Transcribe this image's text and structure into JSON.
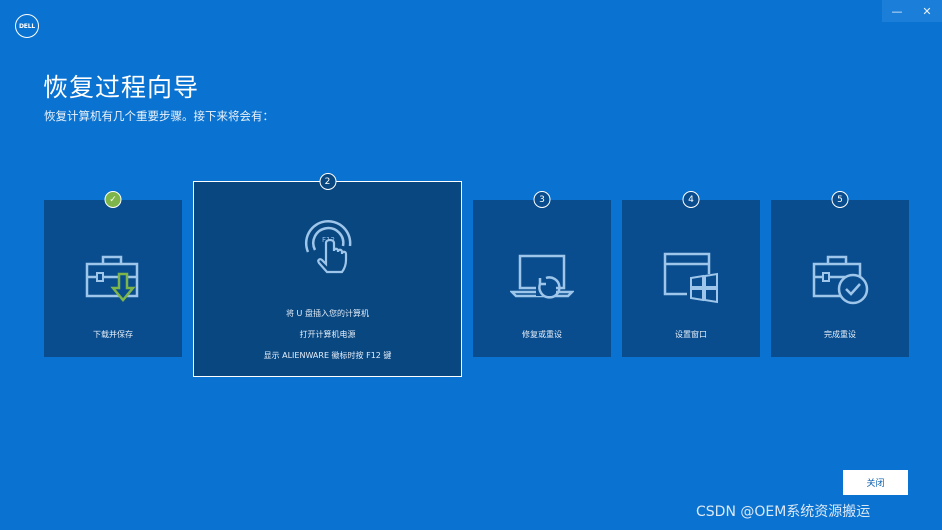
{
  "window": {
    "logo_text": "DELL",
    "minimize_glyph": "—",
    "close_glyph": "✕"
  },
  "header": {
    "title": "恢复过程向导",
    "subtitle": "恢复计算机有几个重要步骤。接下来将会有："
  },
  "steps": [
    {
      "number": "✓",
      "label": "下载并保存",
      "icon": "toolbox-download-icon",
      "state": "done"
    },
    {
      "number": "2",
      "lines": [
        "将 U 盘插入您的计算机",
        "打开计算机电源",
        "显示 ALIENWARE 徽标时按 F12 键"
      ],
      "icon": "finger-press-f12-icon",
      "icon_text": "F12",
      "state": "active"
    },
    {
      "number": "3",
      "label": "修复或重设",
      "icon": "laptop-restore-icon",
      "state": "pending"
    },
    {
      "number": "4",
      "label": "设置窗口",
      "icon": "windows-setup-icon",
      "state": "pending"
    },
    {
      "number": "5",
      "label": "完成重设",
      "icon": "toolbox-check-icon",
      "state": "pending"
    }
  ],
  "footer": {
    "close_label": "关闭",
    "watermark": "CSDN @OEM系统资源搬运"
  },
  "colors": {
    "background": "#0a72d0",
    "card": "#0a4d8e",
    "done_badge": "#7db54a",
    "download_arrow": "#7db54a"
  }
}
